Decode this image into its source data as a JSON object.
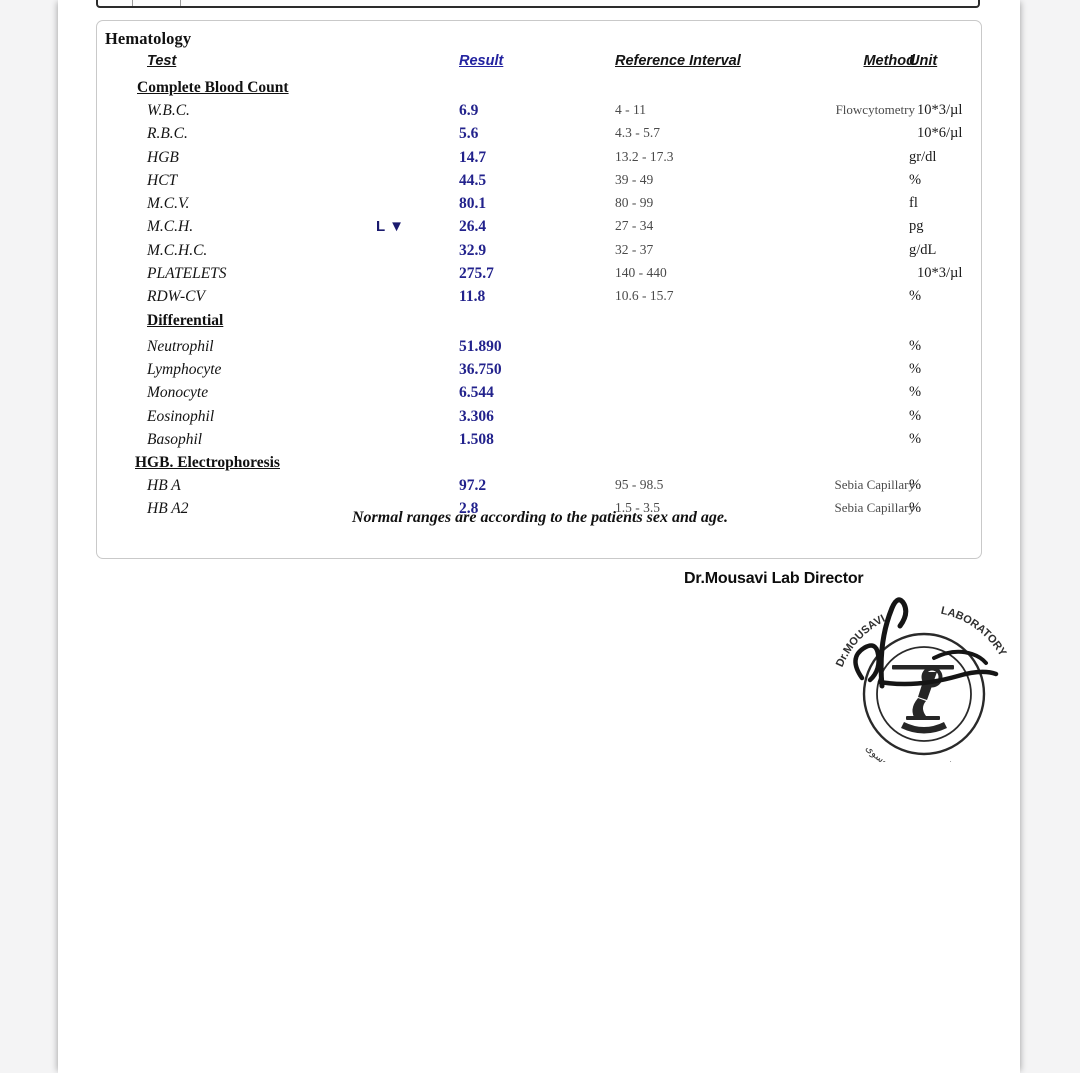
{
  "document": {
    "department_title": "Hematology",
    "footnote": "Normal ranges are according to the patients sex and age."
  },
  "table": {
    "headers": {
      "test": "Test",
      "result": "Result",
      "reference_interval": "Reference Interval",
      "method": "Method",
      "unit": "Unit"
    },
    "sections": [
      {
        "name": "Complete Blood Count",
        "rows": [
          {
            "test": "W.B.C.",
            "flag": "",
            "result": "6.9",
            "reference": "4 - 11",
            "method": "Flowcytometry",
            "unit": "10*3/µl"
          },
          {
            "test": "R.B.C.",
            "flag": "",
            "result": "5.6",
            "reference": "4.3 - 5.7",
            "method": "",
            "unit": "10*6/µl"
          },
          {
            "test": "HGB",
            "flag": "",
            "result": "14.7",
            "reference": "13.2 - 17.3",
            "method": "",
            "unit": "gr/dl"
          },
          {
            "test": "HCT",
            "flag": "",
            "result": "44.5",
            "reference": "39 - 49",
            "method": "",
            "unit": "%"
          },
          {
            "test": "M.C.V.",
            "flag": "",
            "result": "80.1",
            "reference": "80 - 99",
            "method": "",
            "unit": "fl"
          },
          {
            "test": "M.C.H.",
            "flag": "L ▼",
            "result": "26.4",
            "reference": "27 - 34",
            "method": "",
            "unit": "pg"
          },
          {
            "test": "M.C.H.C.",
            "flag": "",
            "result": "32.9",
            "reference": "32 - 37",
            "method": "",
            "unit": "g/dL"
          },
          {
            "test": "PLATELETS",
            "flag": "",
            "result": "275.7",
            "reference": "140 - 440",
            "method": "",
            "unit": "10*3/µl"
          },
          {
            "test": "RDW-CV",
            "flag": "",
            "result": "11.8",
            "reference": "10.6 - 15.7",
            "method": "",
            "unit": "%"
          }
        ]
      },
      {
        "name": "Differential",
        "rows": [
          {
            "test": "Neutrophil",
            "flag": "",
            "result": "51.890",
            "reference": "",
            "method": "",
            "unit": "%"
          },
          {
            "test": "Lymphocyte",
            "flag": "",
            "result": "36.750",
            "reference": "",
            "method": "",
            "unit": "%"
          },
          {
            "test": "Monocyte",
            "flag": "",
            "result": "6.544",
            "reference": "",
            "method": "",
            "unit": "%"
          },
          {
            "test": "Eosinophil",
            "flag": "",
            "result": "3.306",
            "reference": "",
            "method": "",
            "unit": "%"
          },
          {
            "test": "Basophil",
            "flag": "",
            "result": "1.508",
            "reference": "",
            "method": "",
            "unit": "%"
          }
        ]
      },
      {
        "name": "HGB. Electrophoresis",
        "rows": [
          {
            "test": "HB A",
            "flag": "",
            "result": "97.2",
            "reference": "95 - 98.5",
            "method": "Sebia Capillary",
            "unit": "%"
          },
          {
            "test": "HB A2",
            "flag": "",
            "result": "2.8",
            "reference": "1.5 - 3.5",
            "method": "Sebia Capillary",
            "unit": "%"
          }
        ]
      }
    ]
  },
  "signature": {
    "director_name": "Dr.Mousavi Lab Director",
    "stamp": {
      "outer_text_left": "Dr.MOUSAVI",
      "outer_text_right": "LABORATORY",
      "bottom_text": "آزمایشگاه دکتر موسوی",
      "emblem": "microscope-icon"
    }
  },
  "colors": {
    "result_blue": "#22228c",
    "header_blue": "#2323a0",
    "page_background": "#f4f4f5",
    "sheet": "#ffffff",
    "card_border": "#c9c9c9",
    "reference_gray": "#4a4a4a"
  }
}
